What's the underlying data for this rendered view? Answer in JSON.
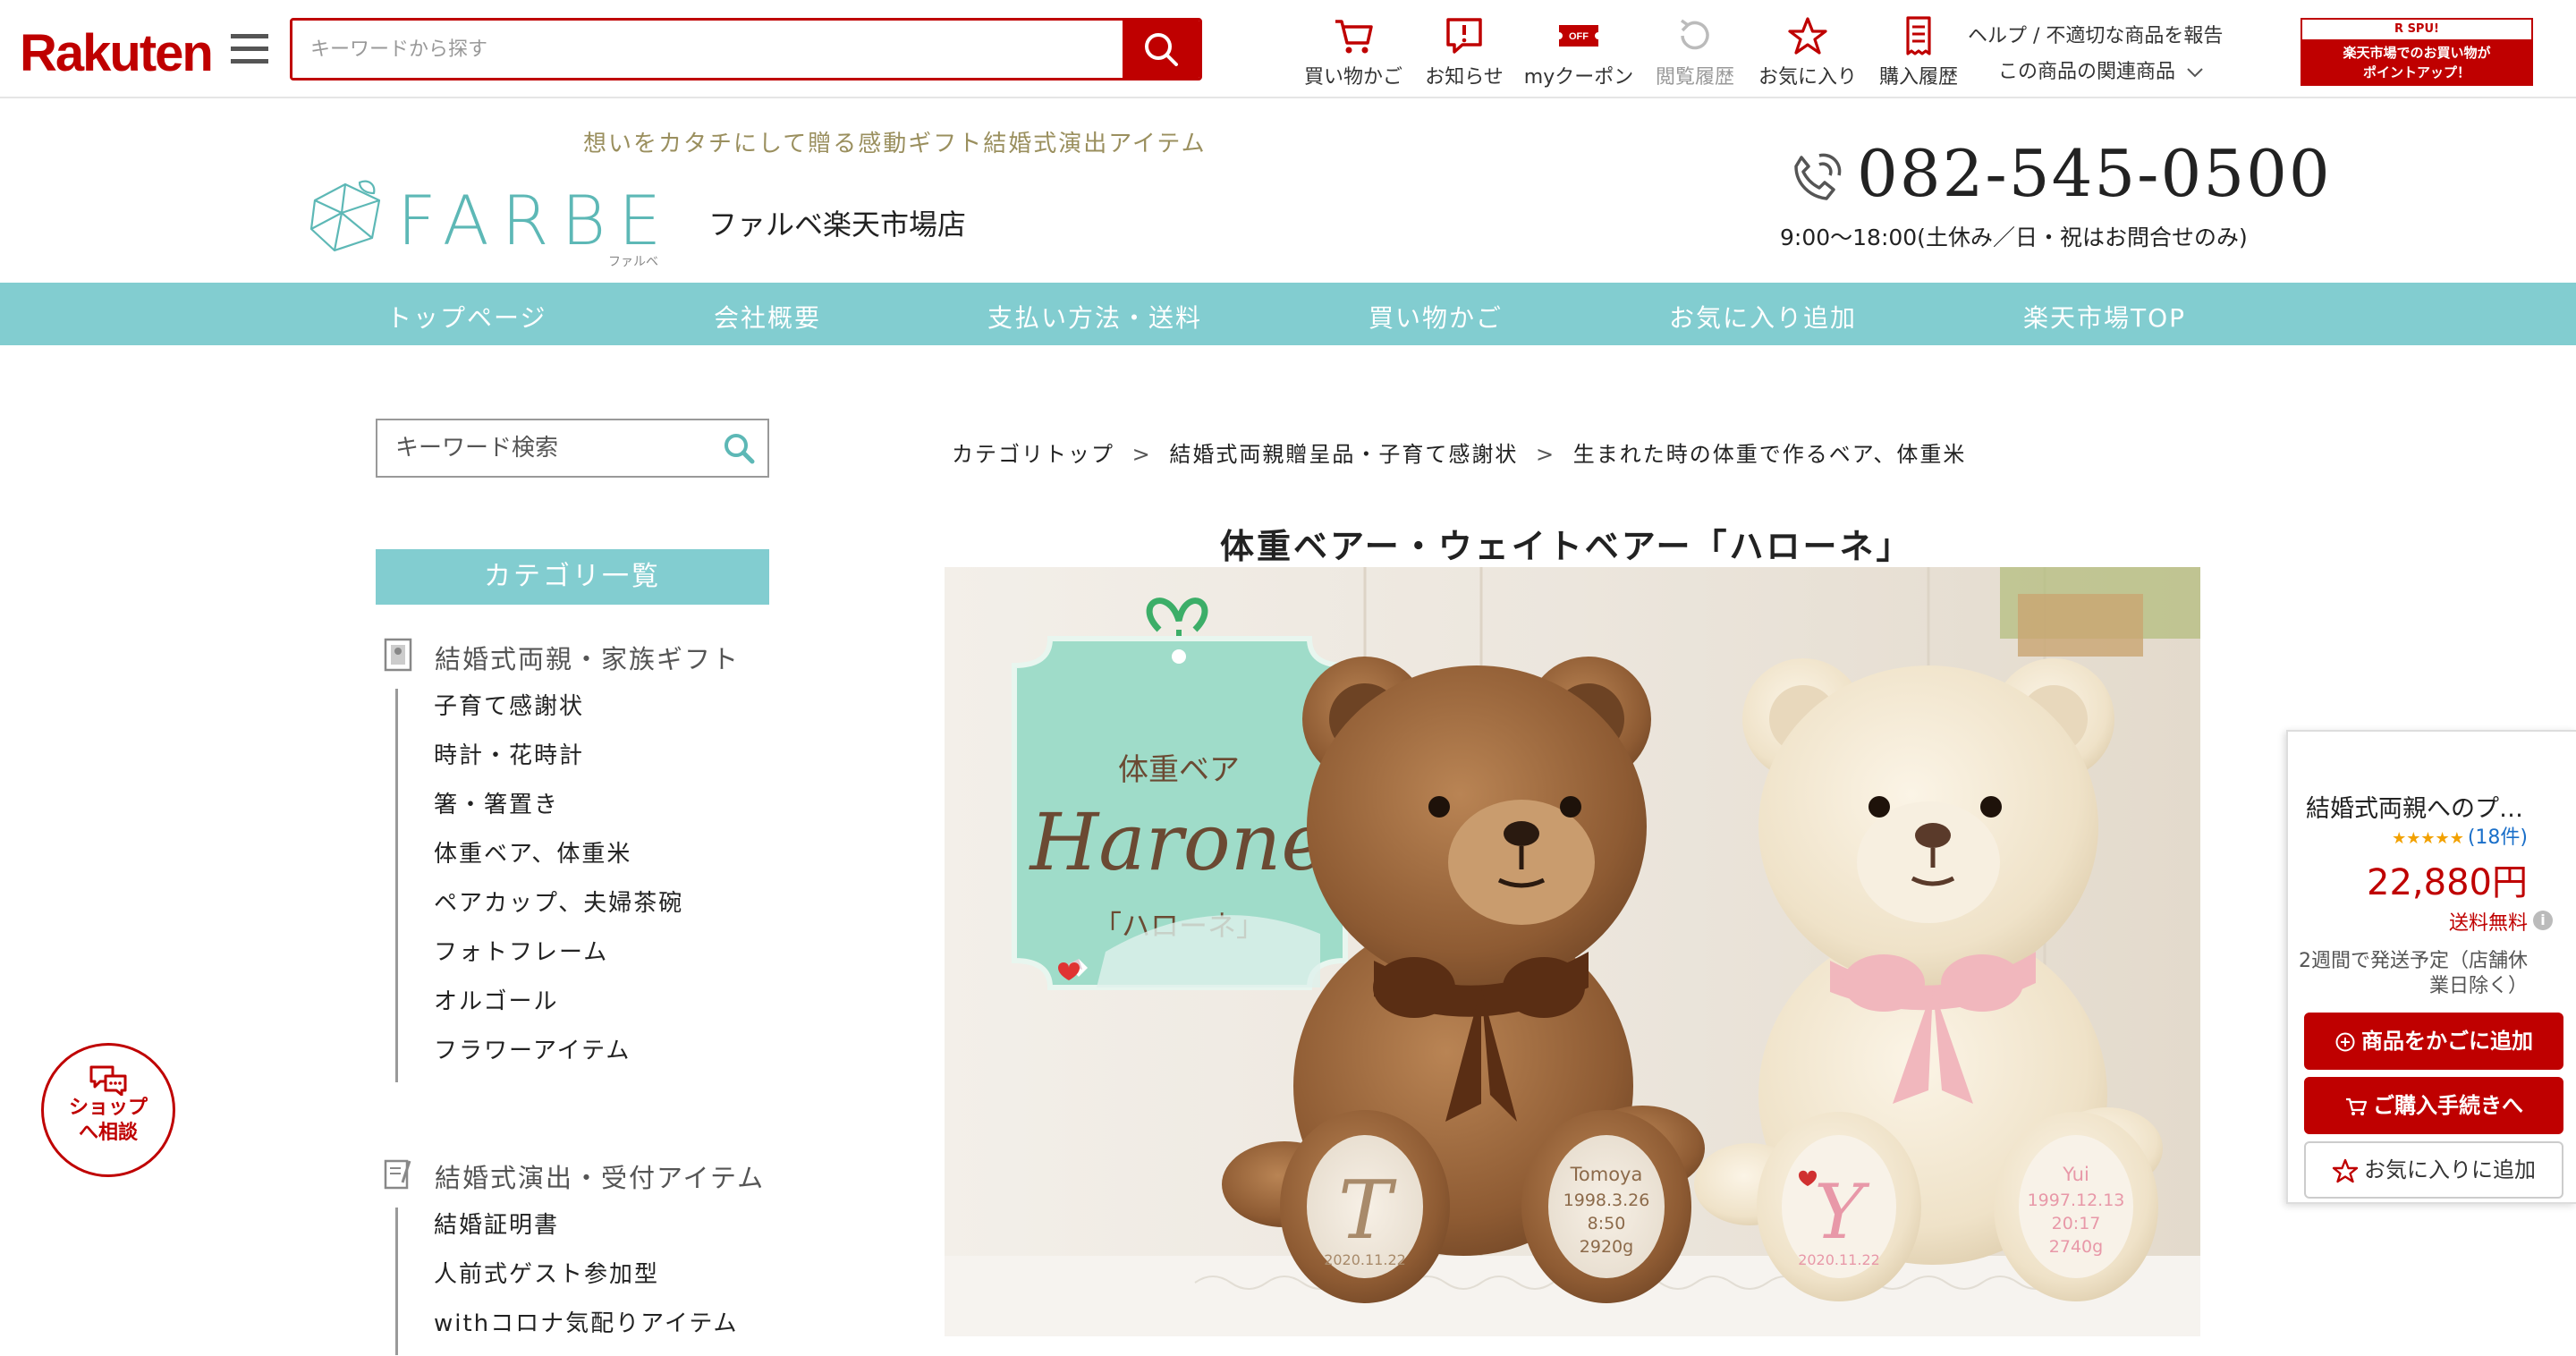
{
  "rakuten": {
    "logo": "Rakuten",
    "search_placeholder": "キーワードから探す",
    "nav": [
      {
        "label": "買い物かご",
        "icon": "cart-icon"
      },
      {
        "label": "お知らせ",
        "icon": "notification-icon"
      },
      {
        "label": "myクーポン",
        "icon": "coupon-icon"
      },
      {
        "label": "閲覧履歴",
        "icon": "history-icon"
      },
      {
        "label": "お気に入り",
        "icon": "star-icon"
      },
      {
        "label": "購入履歴",
        "icon": "receipt-icon"
      }
    ],
    "help": "ヘルプ / 不適切な商品を報告",
    "related": "この商品の関連商品",
    "spu_tag": "R SPU!",
    "spu_line1": "楽天市場でのお買い物が",
    "spu_line2": "ポイントアップ！"
  },
  "shop": {
    "tagline": "想いをカタチにして贈る感動ギフト結婚式演出アイテム",
    "logo_text": "FARBE",
    "logo_sub": "ファルベ",
    "name": "ファルベ楽天市場店",
    "phone": "082-545-0500",
    "hours": "9:00〜18:00(土休み／日・祝はお問合せのみ)",
    "nav": [
      "トップページ",
      "会社概要",
      "支払い方法・送料",
      "買い物かご",
      "お気に入り追加",
      "楽天市場TOP"
    ]
  },
  "sidebar": {
    "search_placeholder": "キーワード検索",
    "category_header": "カテゴリ一覧",
    "groups": [
      {
        "label": "結婚式両親・家族ギフト",
        "items": [
          "子育て感謝状",
          "時計・花時計",
          "箸・箸置き",
          "体重ベア、体重米",
          "ペアカップ、夫婦茶碗",
          "フォトフレーム",
          "オルゴール",
          "フラワーアイテム"
        ]
      },
      {
        "label": "結婚式演出・受付アイテム",
        "items": [
          "結婚証明書",
          "人前式ゲスト参加型",
          "withコロナ気配りアイテム"
        ]
      }
    ]
  },
  "breadcrumb": [
    "カテゴリトップ",
    "結婚式両親贈呈品・子育て感謝状",
    "生まれた時の体重で作るベア、体重米"
  ],
  "breadcrumb_sep": ">",
  "product": {
    "title": "体重ベアー・ウェイトベアー「ハローネ」",
    "image": {
      "tag_title": "体重ベア",
      "tag_script": "Harone",
      "tag_kana": "「ハローネ」",
      "left_paw_initial": "T",
      "left_paw_date": "2020.11.22",
      "left_foot_name": "Tomoya",
      "left_foot_date": "1998.3.26",
      "left_foot_time": "8:50",
      "left_foot_weight": "2920g",
      "right_paw_initial": "Y",
      "right_paw_date": "2020.11.22",
      "right_foot_name": "Yui",
      "right_foot_date": "1997.12.13",
      "right_foot_time": "20:17",
      "right_foot_weight": "2740g"
    }
  },
  "consult": {
    "line1": "ショップ",
    "line2": "へ相談"
  },
  "buybox": {
    "name": "結婚式両親へのプ…",
    "stars": "★★★★★",
    "review_count": "(18件)",
    "price": "22,880円",
    "shipping": "送料無料",
    "eta_line1": "2週間で発送予定（店舗休",
    "eta_line2": "業日除く）",
    "add_cart": "商品をかごに追加",
    "checkout": "ご購入手続きへ",
    "favorite": "お気に入りに追加"
  },
  "colors": {
    "rakuten_red": "#bf0000",
    "shop_teal": "#82cdd0",
    "tagline_olive": "#9a8f5e"
  }
}
